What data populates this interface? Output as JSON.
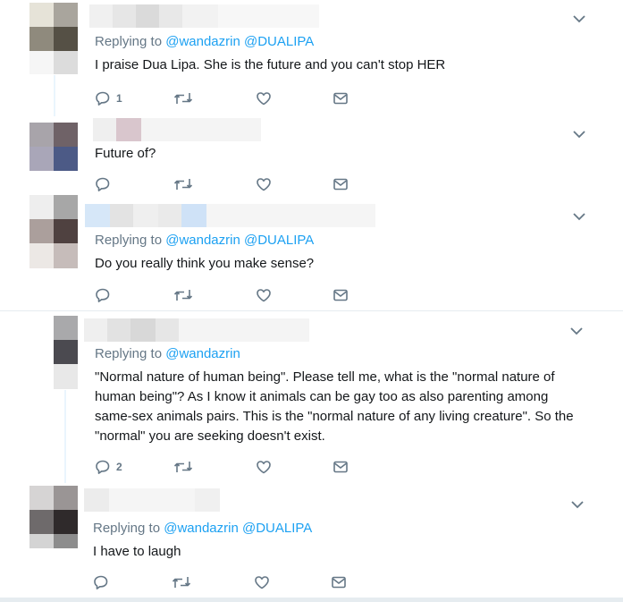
{
  "tweets": [
    {
      "reply_prefix": "Replying to",
      "reply_handles": "@wandazrin @DUALIPA",
      "text": "I praise Dua Lipa. She is the future and you can't stop HER",
      "reply_count": "1"
    },
    {
      "reply_prefix": "",
      "reply_handles": "",
      "text": "Future of?",
      "reply_count": ""
    },
    {
      "reply_prefix": "Replying to",
      "reply_handles": "@wandazrin @DUALIPA",
      "text": "Do you really think you make sense?",
      "reply_count": ""
    },
    {
      "reply_prefix": "Replying to",
      "reply_handles": "@wandazrin",
      "text": "\"Normal nature of human being\". Please tell me, what is the \"normal nature of human being\"? As I know it animals can be gay too as also parenting among same-sex animals pairs. This is the \"normal nature of any living creature\". So the \"normal\" you are seeking doesn't exist.",
      "reply_count": "2"
    },
    {
      "reply_prefix": "Replying to",
      "reply_handles": "@wandazrin @DUALIPA",
      "text": "I have to laugh",
      "reply_count": ""
    }
  ],
  "icons": {
    "reply": "reply-icon",
    "retweet": "retweet-icon",
    "like": "heart-icon",
    "dm": "envelope-icon",
    "more": "chevron-down-icon"
  },
  "colors": {
    "link": "#1da1f2",
    "muted": "#657786",
    "divider": "#e6ecf0"
  }
}
